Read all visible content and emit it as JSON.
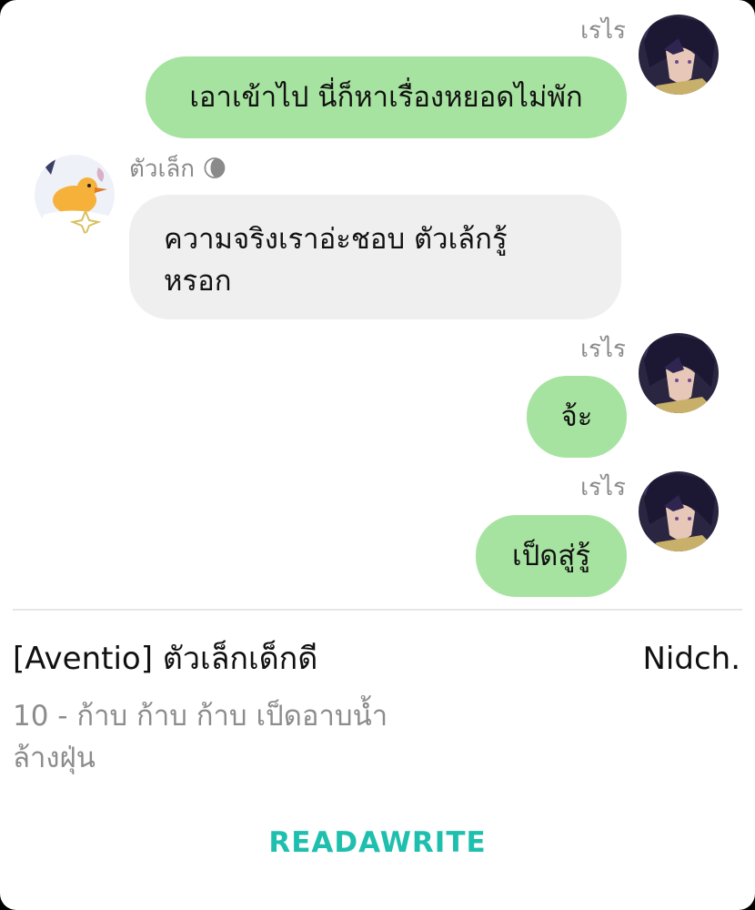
{
  "messages": [
    {
      "side": "right",
      "sender": "เรไร",
      "text": "เอาเข้าไป นี่ก็หาเรื่องหยอดไม่พัก"
    },
    {
      "side": "left",
      "sender": "ตัวเล็ก",
      "sender_emoji": "🌘",
      "text_lines": [
        "ความจริงเราอ่ะชอบ ตัวเล้กรู้",
        "หรอก"
      ]
    },
    {
      "side": "right",
      "sender": "เรไร",
      "text": "จ้ะ"
    },
    {
      "side": "right",
      "sender": "เรไร",
      "text": "เป็ดสู่รู้"
    }
  ],
  "footer": {
    "story_title": "[Aventio] ตัวเล็กเด็กดี",
    "author": "Nidch.",
    "chapter_line1": "10 - ก้าบ ก้าบ ก้าบ เป็ดอาบน้ำ",
    "chapter_line2": "ล้างฝุ่น",
    "logo": "READAWRITE"
  },
  "colors": {
    "my_bubble": "#a7e3a0",
    "their_bubble": "#efefef",
    "logo": "#1fbfae",
    "sender_name": "#8a8a8a"
  },
  "icons": {
    "my_avatar": "anime-character-avatar",
    "their_avatar": "duck-avatar"
  }
}
